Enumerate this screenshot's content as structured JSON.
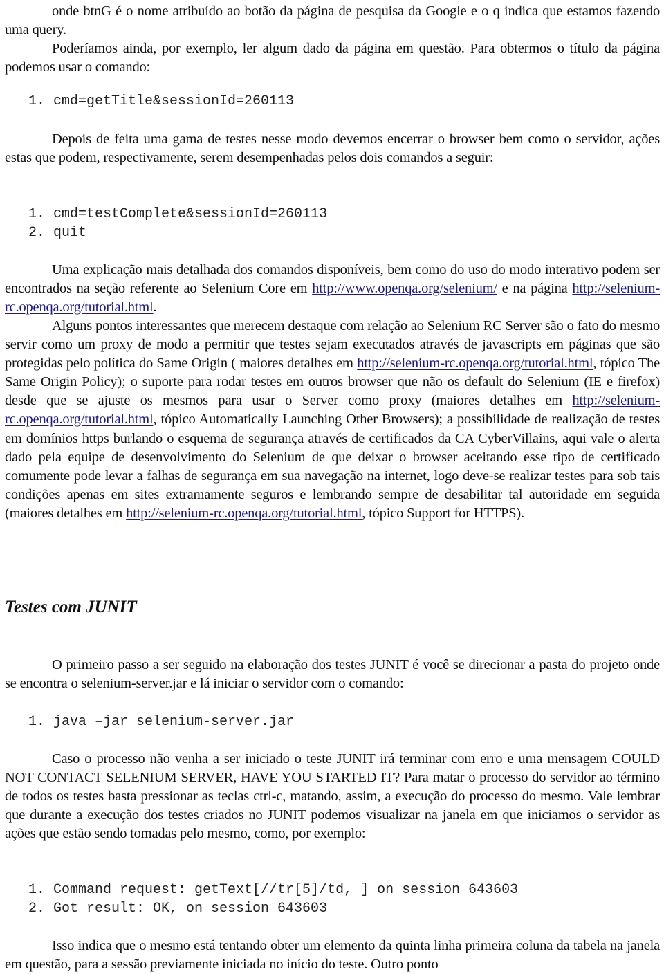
{
  "paragraphs": {
    "p1": "onde btnG é o nome atribuído ao botão da página de pesquisa da Google e o q indica que estamos fazendo uma query.",
    "p2": "Poderíamos ainda, por exemplo, ler algum dado da página em questão. Para obtermos o título da página podemos usar o comando:",
    "p3": "Depois de feita uma gama de testes nesse modo devemos encerrar o browser bem como o servidor, ações estas que podem, respectivamente, serem desempenhadas pelos dois comandos a seguir:",
    "p4": {
      "text_before": "Uma explicação mais detalhada dos comandos disponíveis, bem como do uso do modo interativo podem ser encontrados na seção referente ao Selenium Core em ",
      "link1": "http://www.openqa.org/selenium/",
      "text_middle": " e na página ",
      "link2": "http://selenium-rc.openqa.org/tutorial.html",
      "text_after": "."
    },
    "p5": {
      "text1": "Alguns pontos interessantes que merecem destaque com relação ao Selenium RC Server são o fato do mesmo servir como um proxy de modo a permitir que testes sejam executados através de javascripts em páginas que são protegidas pelo política do Same Origin ( maiores detalhes em ",
      "link1": "http://selenium-rc.openqa.org/tutorial.html",
      "text2": ", tópico The Same Origin Policy); o suporte para rodar testes em outros browser que não os default do Selenium (IE e firefox) desde que se ajuste os mesmos para usar o Server como proxy (maiores detalhes em ",
      "link2": "http://selenium-rc.openqa.org/tutorial.html",
      "text3": ", tópico Automatically Launching Other Browsers); a possibilidade de realização de testes em domínios https burlando o esquema de segurança através de certificados da CA CyberVillains, aqui vale o alerta dado pela equipe de desenvolvimento do Selenium de que deixar o browser aceitando esse tipo de certificado comumente pode levar a falhas de segurança em sua navegação na internet, logo deve-se realizar testes para sob tais condições apenas em sites extramamente seguros e lembrando sempre de desabilitar tal autoridade em seguida (maiores detalhes em ",
      "link3": "http://selenium-rc.openqa.org/tutorial.html",
      "text4": ", tópico Support for HTTPS)."
    },
    "heading": "Testes com JUNIT",
    "p6": "O primeiro passo a ser seguido na elaboração dos testes JUNIT é você se direcionar a pasta do projeto onde se encontra o selenium-server.jar e  lá iniciar o servidor com o comando:",
    "p7": "Caso o processo não venha a ser iniciado o teste JUNIT irá terminar com erro e uma mensagem COULD NOT CONTACT SELENIUM SERVER, HAVE YOU STARTED IT? Para matar o processo do servidor ao término de todos os testes basta pressionar as teclas ctrl-c, matando, assim, a execução do processo do mesmo. Vale lembrar que durante a execução dos testes criados no JUNIT podemos visualizar na janela em que iniciamos o servidor as ações que estão sendo tomadas pelo mesmo, como, por exemplo:",
    "p8": "Isso indica que o mesmo está tentando obter um elemento da quinta linha primeira coluna da tabela na janela em questão, para a sessão previamente iniciada no início do teste. Outro ponto"
  },
  "code_blocks": {
    "get_title": [
      {
        "num": "1.",
        "code": "cmd=getTitle&sessionId=260113"
      }
    ],
    "close": [
      {
        "num": "1.",
        "code": "cmd=testComplete&sessionId=260113"
      },
      {
        "num": "2.",
        "code": "quit"
      }
    ],
    "start_server": [
      {
        "num": "1.",
        "code": "java –jar selenium-server.jar"
      }
    ],
    "log": [
      {
        "num": "1.",
        "code": "Command request: getText[//tr[5]/td, ] on session 643603"
      },
      {
        "num": "2.",
        "code": "Got result: OK, on session 643603"
      }
    ]
  }
}
